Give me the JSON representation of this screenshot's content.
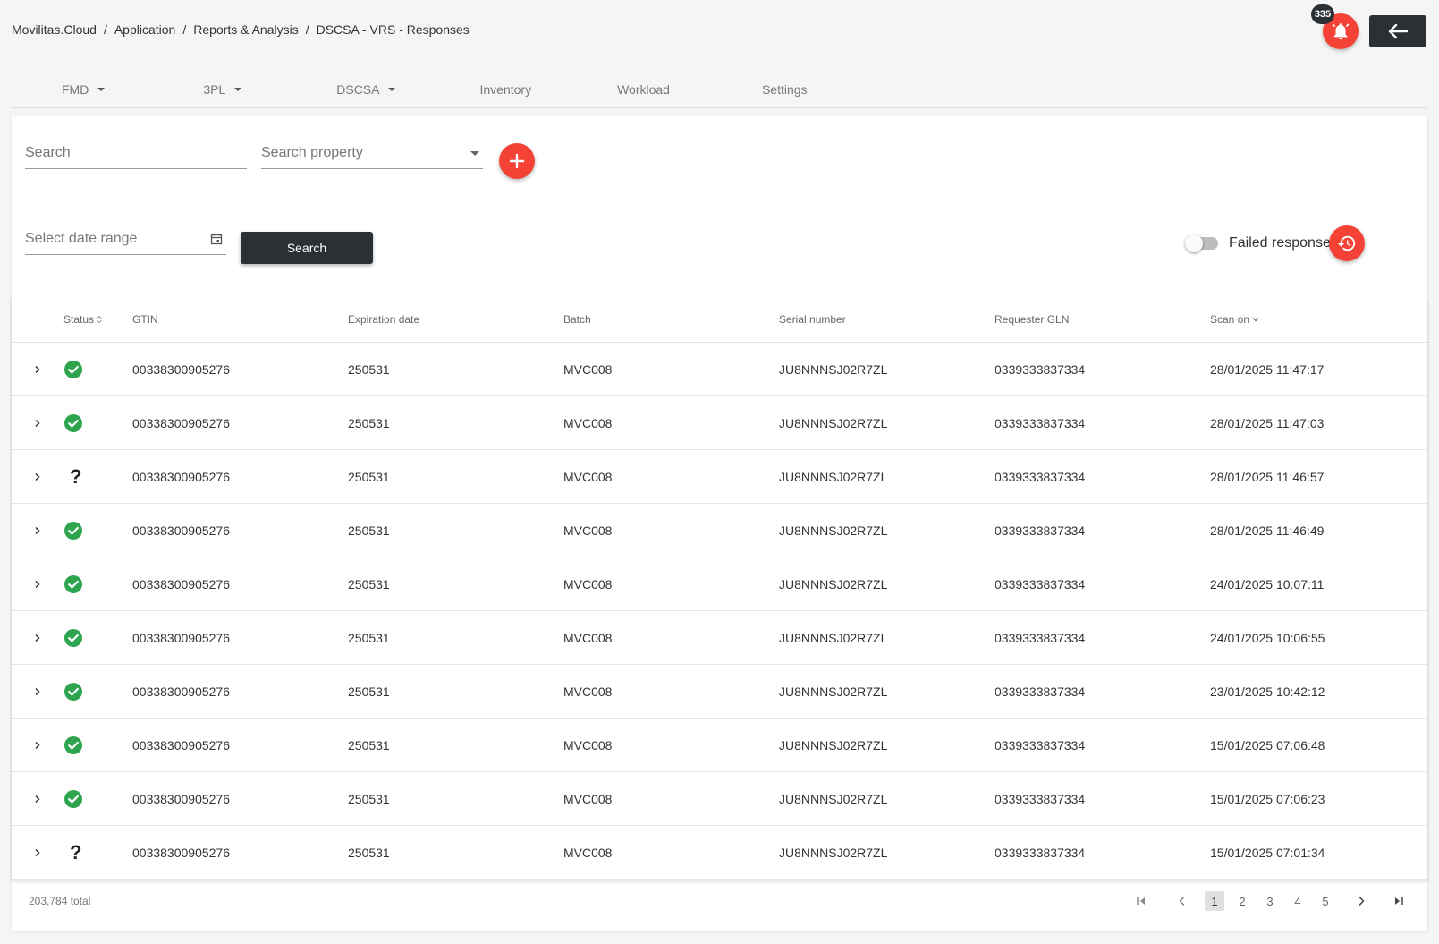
{
  "breadcrumb": [
    "Movilitas.Cloud",
    "Application",
    "Reports & Analysis",
    "DSCSA - VRS - Responses"
  ],
  "notifications": {
    "count": "335"
  },
  "colors": {
    "accent": "#f44336",
    "dark": "#2b3035",
    "success": "#2ea44f"
  },
  "tabs": [
    {
      "label": "FMD",
      "dropdown": true
    },
    {
      "label": "3PL",
      "dropdown": true
    },
    {
      "label": "DSCSA",
      "dropdown": true
    },
    {
      "label": "Inventory",
      "dropdown": false
    },
    {
      "label": "Workload",
      "dropdown": false
    },
    {
      "label": "Settings",
      "dropdown": false
    }
  ],
  "filters": {
    "search_placeholder": "Search",
    "property_placeholder": "Search property",
    "date_placeholder": "Select date range",
    "search_button": "Search",
    "failed_toggle_label": "Failed responses"
  },
  "table": {
    "headers": [
      "Status",
      "GTIN",
      "Expiration date",
      "Batch",
      "Serial number",
      "Requester GLN",
      "Scan on"
    ],
    "rows": [
      {
        "status": "success",
        "gtin": "00338300905276",
        "expiration": "250531",
        "batch": "MVC008",
        "serial": "JU8NNNSJ02R7ZL",
        "gln": "0339333837334",
        "scan_on": "28/01/2025 11:47:17"
      },
      {
        "status": "success",
        "gtin": "00338300905276",
        "expiration": "250531",
        "batch": "MVC008",
        "serial": "JU8NNNSJ02R7ZL",
        "gln": "0339333837334",
        "scan_on": "28/01/2025 11:47:03"
      },
      {
        "status": "unknown",
        "gtin": "00338300905276",
        "expiration": "250531",
        "batch": "MVC008",
        "serial": "JU8NNNSJ02R7ZL",
        "gln": "0339333837334",
        "scan_on": "28/01/2025 11:46:57"
      },
      {
        "status": "success",
        "gtin": "00338300905276",
        "expiration": "250531",
        "batch": "MVC008",
        "serial": "JU8NNNSJ02R7ZL",
        "gln": "0339333837334",
        "scan_on": "28/01/2025 11:46:49"
      },
      {
        "status": "success",
        "gtin": "00338300905276",
        "expiration": "250531",
        "batch": "MVC008",
        "serial": "JU8NNNSJ02R7ZL",
        "gln": "0339333837334",
        "scan_on": "24/01/2025 10:07:11"
      },
      {
        "status": "success",
        "gtin": "00338300905276",
        "expiration": "250531",
        "batch": "MVC008",
        "serial": "JU8NNNSJ02R7ZL",
        "gln": "0339333837334",
        "scan_on": "24/01/2025 10:06:55"
      },
      {
        "status": "success",
        "gtin": "00338300905276",
        "expiration": "250531",
        "batch": "MVC008",
        "serial": "JU8NNNSJ02R7ZL",
        "gln": "0339333837334",
        "scan_on": "23/01/2025 10:42:12"
      },
      {
        "status": "success",
        "gtin": "00338300905276",
        "expiration": "250531",
        "batch": "MVC008",
        "serial": "JU8NNNSJ02R7ZL",
        "gln": "0339333837334",
        "scan_on": "15/01/2025 07:06:48"
      },
      {
        "status": "success",
        "gtin": "00338300905276",
        "expiration": "250531",
        "batch": "MVC008",
        "serial": "JU8NNNSJ02R7ZL",
        "gln": "0339333837334",
        "scan_on": "15/01/2025 07:06:23"
      },
      {
        "status": "unknown",
        "gtin": "00338300905276",
        "expiration": "250531",
        "batch": "MVC008",
        "serial": "JU8NNNSJ02R7ZL",
        "gln": "0339333837334",
        "scan_on": "15/01/2025 07:01:34"
      }
    ]
  },
  "pagination": {
    "total": "203,784 total",
    "pages": [
      "1",
      "2",
      "3",
      "4",
      "5"
    ],
    "current": "1"
  }
}
